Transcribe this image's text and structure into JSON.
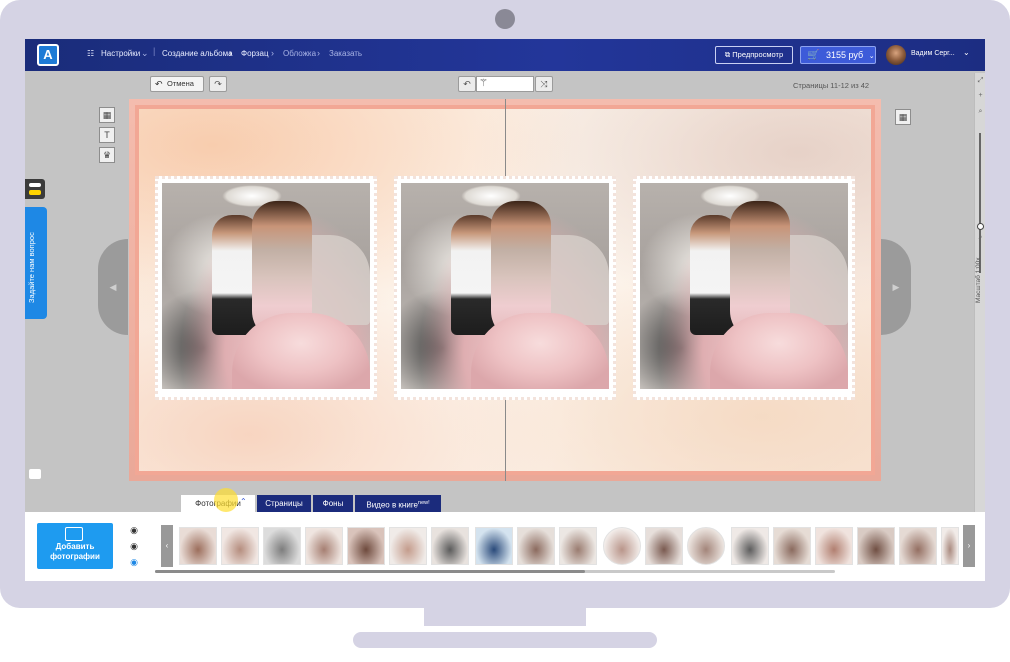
{
  "header": {
    "logo_letter": "A",
    "settings_label": "Настройки",
    "breadcrumb": [
      "Создание альбома",
      "Форзац",
      "Обложка",
      "Заказать"
    ],
    "preview_label": "Предпросмотр",
    "cart_price": "3155 руб",
    "user_name": "Вадим Серг..."
  },
  "toolbar": {
    "undo_label": "Отмена",
    "page_counter": "Страницы 11-12 из 42"
  },
  "side": {
    "question_label": "Задайте нам вопрос"
  },
  "zoom": {
    "label": "Масштаб 1:00x"
  },
  "tabs": [
    {
      "label": "Фотографии"
    },
    {
      "label": "Страницы"
    },
    {
      "label": "Фоны"
    },
    {
      "label": "Видео в книге",
      "badge": "new!"
    }
  ],
  "tray": {
    "add_button_label": "Добавить фотографии"
  },
  "colors": {
    "nav_bg": "#1a2c7a",
    "accent": "#1e9bf0",
    "tab_bg": "#1b2b7c",
    "page_border": "#f2a795"
  },
  "icons": {
    "settings": "sliders-icon",
    "preview": "external-link-icon",
    "cart": "cart-icon",
    "undo": "undo-icon",
    "redo": "redo-icon",
    "shuffle": "shuffle-icon",
    "add_photos": "add-photo-icon",
    "eye": "eye-icon"
  }
}
